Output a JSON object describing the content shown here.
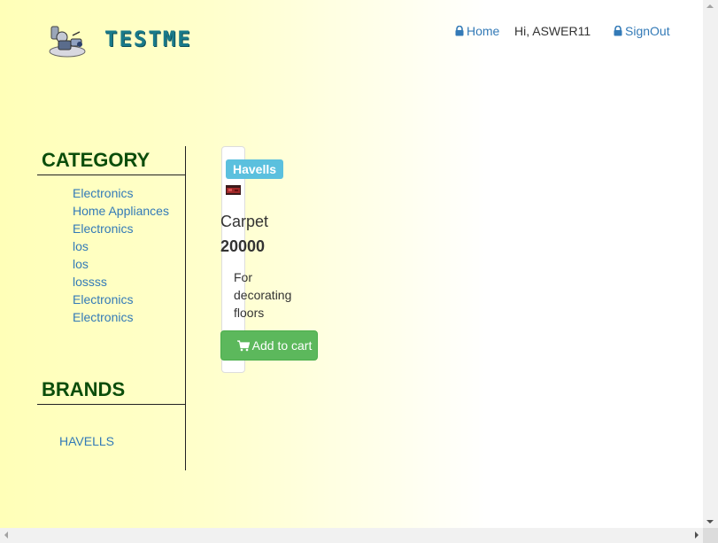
{
  "header": {
    "brand": "TESTME",
    "nav": {
      "home_label": "Home",
      "greeting": "Hi, ASWER11",
      "signout_label": "SignOut"
    },
    "icons": {
      "home": "lock-icon",
      "signout": "lock-icon",
      "logo": "robot-logo-icon"
    }
  },
  "sidebar": {
    "category_heading": "CATEGORY",
    "categories": [
      "Electronics",
      "Home Appliances",
      "Electronics",
      "los",
      "los",
      "lossss",
      "Electronics",
      "Electronics"
    ],
    "brands_heading": "BRANDS",
    "brands": [
      "HAVELLS"
    ]
  },
  "product": {
    "brand_badge": "Havells",
    "name": "Carpet",
    "price": "20000",
    "description": "For decorating floors",
    "add_to_cart_label": "Add to cart",
    "add_to_cart_icon": "shopping-cart-icon"
  },
  "colors": {
    "link": "#337ab7",
    "heading": "#0b4d0b",
    "badge": "#5bc0de",
    "button": "#5cb85c",
    "brand_text": "#1a7a8a"
  }
}
